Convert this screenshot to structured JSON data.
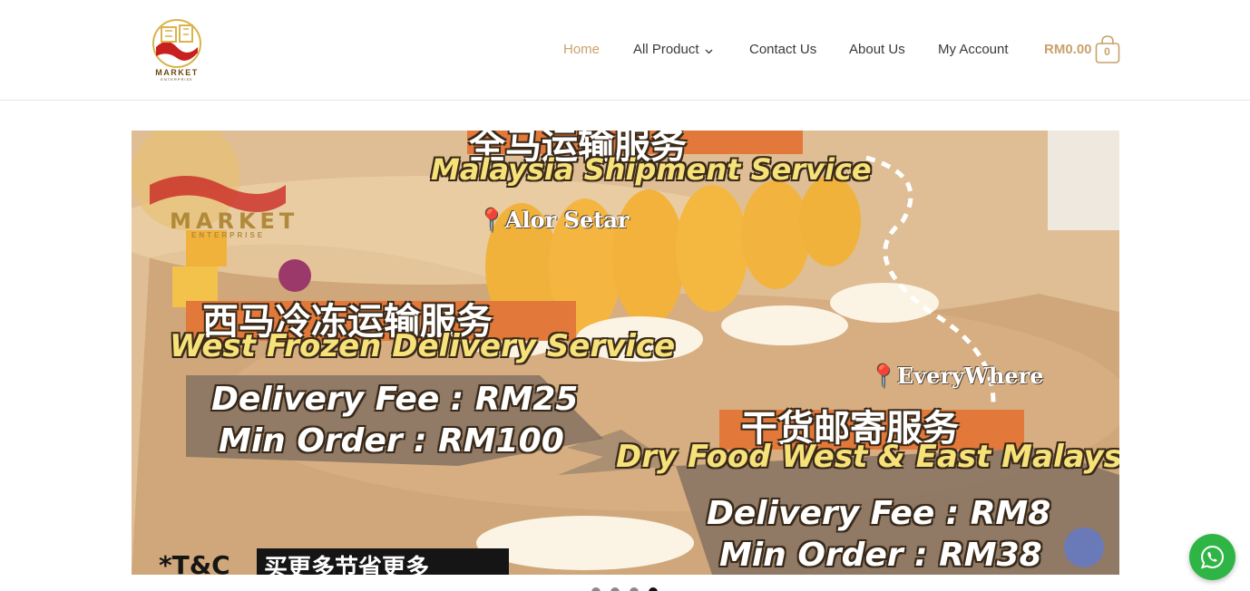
{
  "header": {
    "logo": {
      "text": "MARKET",
      "sub": "ENTERPRISE",
      "icon": "market-logo"
    },
    "nav": [
      {
        "label": "Home",
        "active": true
      },
      {
        "label": "All Product",
        "has_dropdown": true
      },
      {
        "label": "Contact Us"
      },
      {
        "label": "About Us"
      },
      {
        "label": "My Account"
      }
    ],
    "cart": {
      "total": "RM0.00",
      "count": "0",
      "icon": "shopping-bag-icon"
    }
  },
  "slider": {
    "image_logo": {
      "text": "MARKET",
      "sub": "ENTERPRISE"
    },
    "shipment_cn": "全马运输服务",
    "shipment_en": "Malaysia Shipment Service",
    "location_1": "Alor Setar",
    "west_cn": "西马冷冻运输服务",
    "west_en": "West Frozen Delivery Service",
    "west_fee": "Delivery Fee : RM25",
    "west_min": "Min Order : RM100",
    "location_2": "EveryWhere",
    "dry_cn": "干货邮寄服务",
    "dry_en": "Dry Food West & East Malaysia",
    "dry_fee": "Delivery Fee : RM8",
    "dry_min": "Min Order : RM38",
    "tc": "*T&C",
    "tc_cn": "买更多节省更多",
    "dots": {
      "count": 4,
      "active_index": 3
    }
  },
  "colors": {
    "accent": "#c9a26a",
    "nav_text": "#3a3a3a",
    "whatsapp": "#2fb546",
    "banner_orange": "#e2793a"
  },
  "whatsapp": {
    "icon": "whatsapp-icon"
  }
}
